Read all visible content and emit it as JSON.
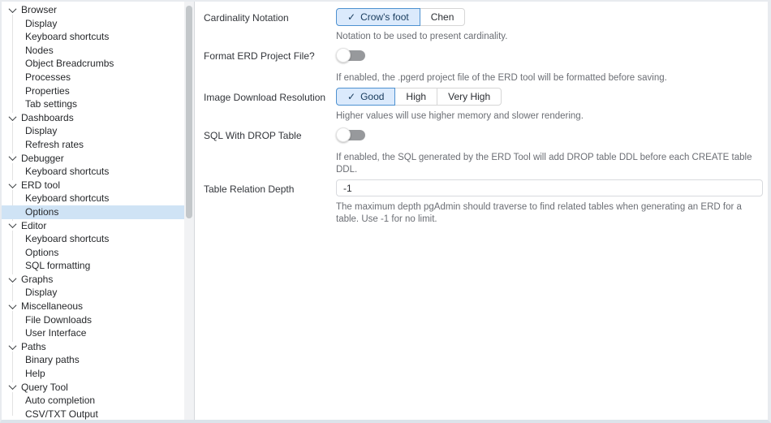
{
  "app": "pgAdmin Preferences",
  "colors": {
    "selected_row_bg": "#cfe3f5",
    "selected_button_bg": "#dbeafc",
    "selected_button_border": "#4d91d0",
    "selected_button_text": "#173a5c",
    "frame_border": "#e8ebef",
    "toggle_track": "#97999c"
  },
  "icons": {
    "category_chevron": "chevron-down-icon",
    "selected_option_check": "check-icon"
  },
  "sidebar": {
    "selected_item": "Options",
    "selected_group": "ERD tool",
    "groups": [
      {
        "label": "Browser",
        "children": [
          "Display",
          "Keyboard shortcuts",
          "Nodes",
          "Object Breadcrumbs",
          "Processes",
          "Properties",
          "Tab settings"
        ]
      },
      {
        "label": "Dashboards",
        "children": [
          "Display",
          "Refresh rates"
        ]
      },
      {
        "label": "Debugger",
        "children": [
          "Keyboard shortcuts"
        ]
      },
      {
        "label": "ERD tool",
        "children": [
          "Keyboard shortcuts",
          "Options"
        ]
      },
      {
        "label": "Editor",
        "children": [
          "Keyboard shortcuts",
          "Options",
          "SQL formatting"
        ]
      },
      {
        "label": "Graphs",
        "children": [
          "Display"
        ]
      },
      {
        "label": "Miscellaneous",
        "children": [
          "File Downloads",
          "User Interface"
        ]
      },
      {
        "label": "Paths",
        "children": [
          "Binary paths",
          "Help"
        ]
      },
      {
        "label": "Query Tool",
        "children": [
          "Auto completion",
          "CSV/TXT Output"
        ]
      }
    ]
  },
  "main": {
    "rows": [
      {
        "type": "buttongroup",
        "label": "Cardinality Notation",
        "options": [
          {
            "label": "Crow's foot",
            "selected": true
          },
          {
            "label": "Chen",
            "selected": false
          }
        ],
        "help": "Notation to be used to present cardinality."
      },
      {
        "type": "toggle",
        "label": "Format ERD Project File?",
        "value": false,
        "help": "If enabled, the .pgerd project file of the ERD tool will be formatted before saving."
      },
      {
        "type": "buttongroup",
        "label": "Image Download Resolution",
        "options": [
          {
            "label": "Good",
            "selected": true
          },
          {
            "label": "High",
            "selected": false
          },
          {
            "label": "Very High",
            "selected": false
          }
        ],
        "help": "Higher values will use higher memory and slower rendering."
      },
      {
        "type": "toggle",
        "label": "SQL With DROP Table",
        "value": false,
        "help": "If enabled, the SQL generated by the ERD Tool will add DROP table DDL before each CREATE table DDL."
      },
      {
        "type": "input",
        "label": "Table Relation Depth",
        "value": "-1",
        "help": "The maximum depth pgAdmin should traverse to find related tables when generating an ERD for a table. Use -1 for no limit."
      }
    ]
  }
}
